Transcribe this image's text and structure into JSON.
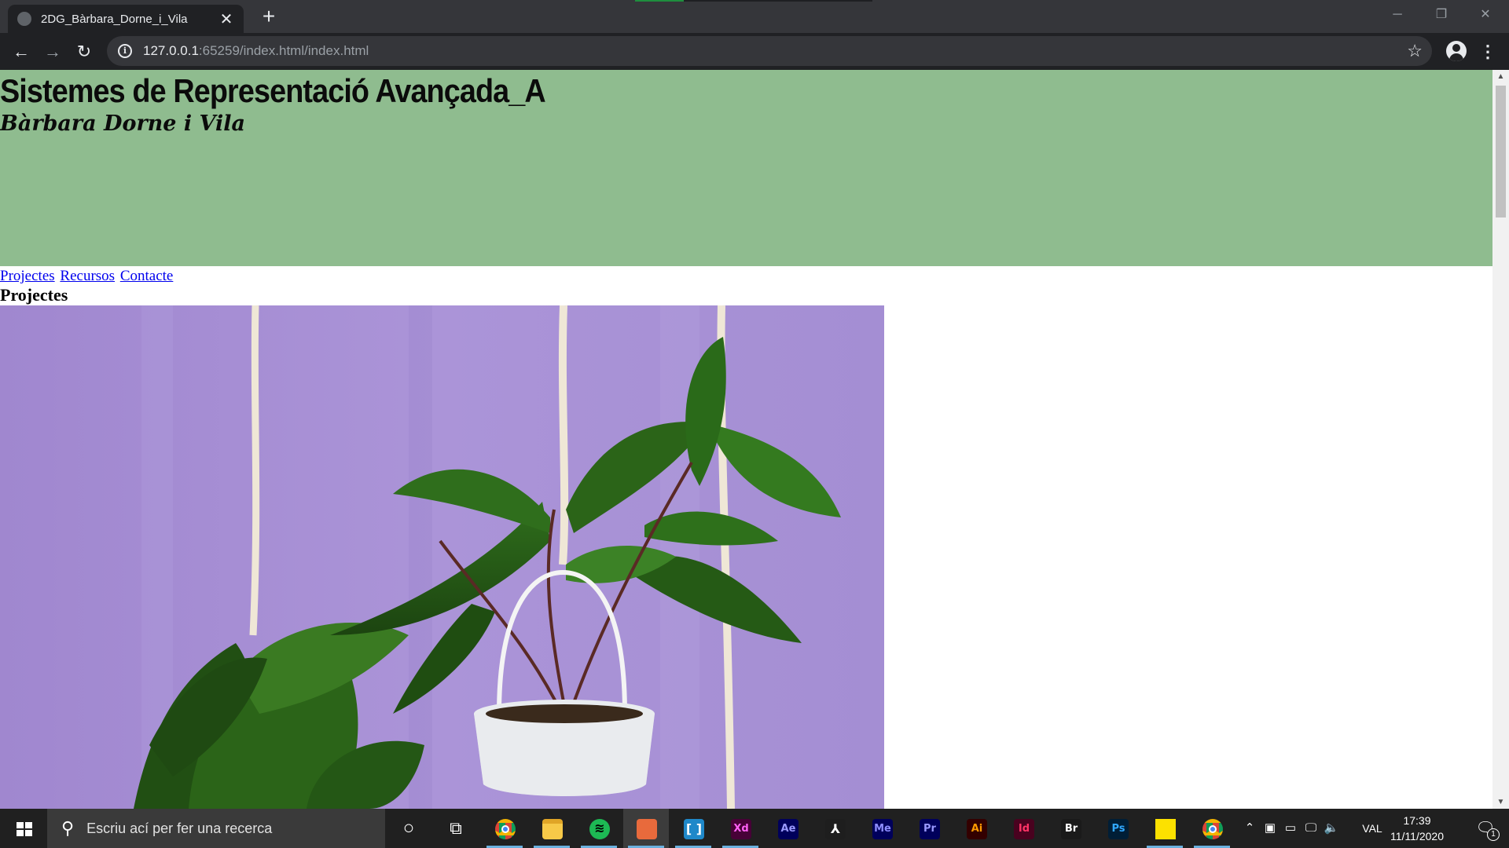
{
  "browser": {
    "tab_title": "2DG_Bàrbara_Dorne_i_Vila",
    "tab_close": "✕",
    "new_tab": "+",
    "url_host": "127.0.0.1",
    "url_rest": ":65259/index.html/index.html",
    "icons": [
      "back-icon",
      "forward-icon",
      "reload-icon",
      "info-icon",
      "star-icon",
      "account-icon",
      "menu-icon"
    ]
  },
  "page": {
    "title": "Sistemes de Representació Avançada_A",
    "subtitle": "Bàrbara Dorne i Vila",
    "nav": [
      "Projectes",
      "Recursos",
      "Contacte"
    ],
    "section_heading": "Projectes",
    "header_color": "#8fbc8f",
    "image_wall_color": "#a48fd1"
  },
  "taskbar": {
    "search_placeholder": "Escriu ací per fer una recerca",
    "apps": [
      {
        "name": "chrome",
        "label": ""
      },
      {
        "name": "file-explorer",
        "label": ""
      },
      {
        "name": "spotify",
        "label": ""
      },
      {
        "name": "paint-app",
        "label": ""
      },
      {
        "name": "brackets-app",
        "label": ""
      },
      {
        "name": "adobe-xd",
        "label": "Xd"
      },
      {
        "name": "after-effects",
        "label": "Ae"
      },
      {
        "name": "acrobat",
        "label": ""
      },
      {
        "name": "media-encoder",
        "label": "Me"
      },
      {
        "name": "premiere-pro",
        "label": "Pr"
      },
      {
        "name": "illustrator",
        "label": "Ai"
      },
      {
        "name": "indesign",
        "label": "Id"
      },
      {
        "name": "bridge",
        "label": "Br"
      },
      {
        "name": "photoshop",
        "label": "Ps"
      },
      {
        "name": "sticky-notes",
        "label": ""
      },
      {
        "name": "chrome-2",
        "label": ""
      }
    ],
    "language": "VAL",
    "time": "17:39",
    "date": "11/11/2020",
    "notification_count": "1"
  }
}
